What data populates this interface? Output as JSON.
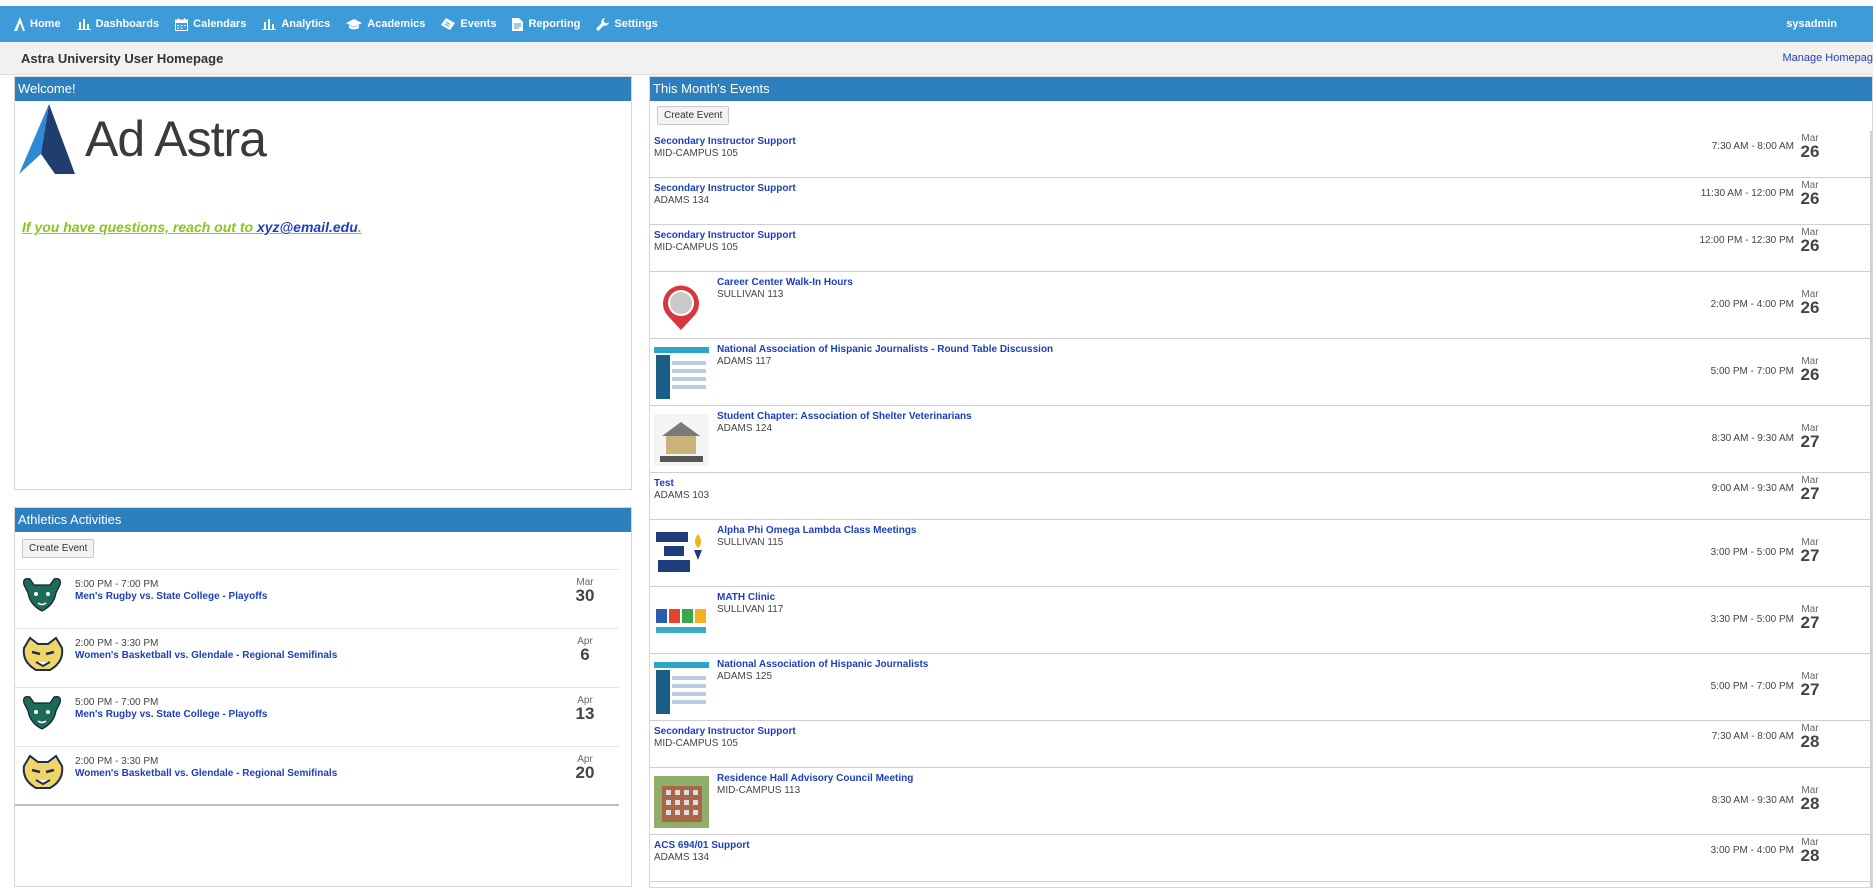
{
  "nav": {
    "items": [
      {
        "label": "Home",
        "icon": "astra-icon"
      },
      {
        "label": "Dashboards",
        "icon": "bar-chart-icon"
      },
      {
        "label": "Calendars",
        "icon": "calendar-icon"
      },
      {
        "label": "Analytics",
        "icon": "bar-chart-icon"
      },
      {
        "label": "Academics",
        "icon": "graduation-cap-icon"
      },
      {
        "label": "Events",
        "icon": "ticket-icon"
      },
      {
        "label": "Reporting",
        "icon": "document-icon"
      },
      {
        "label": "Settings",
        "icon": "wrench-icon"
      }
    ],
    "user": "sysadmin",
    "bar_color": "#3c9bd8"
  },
  "page": {
    "title": "Astra University User Homepage",
    "manage_link": "Manage Homepag"
  },
  "welcome": {
    "header": "Welcome!",
    "logo_text": "Ad Astra",
    "message_prefix": "If you have questions, reach out to ",
    "email": "xyz@email.edu",
    "message_suffix": "."
  },
  "athletics": {
    "header": "Athletics Activities",
    "create_label": "Create Event",
    "items": [
      {
        "time": "5:00 PM - 7:00 PM",
        "name": "Men's Rugby vs. State College - Playoffs",
        "month": "Mar",
        "day": "30",
        "logo": "bison-icon"
      },
      {
        "time": "2:00 PM - 3:30 PM",
        "name": "Women's Basketball vs. Glendale - Regional Semifinals",
        "month": "Apr",
        "day": "6",
        "logo": "cougar-icon"
      },
      {
        "time": "5:00 PM - 7:00 PM",
        "name": "Men's Rugby vs. State College - Playoffs",
        "month": "Apr",
        "day": "13",
        "logo": "bison-icon"
      },
      {
        "time": "2:00 PM - 3:30 PM",
        "name": "Women's Basketball vs. Glendale - Regional Semifinals",
        "month": "Apr",
        "day": "20",
        "logo": "cougar-icon"
      }
    ]
  },
  "events": {
    "header": "This Month's Events",
    "create_label": "Create Event",
    "items": [
      {
        "title": "Secondary Instructor Support",
        "location": "MID-CAMPUS 105",
        "time": "7:30 AM - 8:00 AM",
        "month": "Mar",
        "day": "26",
        "icon": ""
      },
      {
        "title": "Secondary Instructor Support",
        "location": "ADAMS 134",
        "time": "11:30 AM - 12:00 PM",
        "month": "Mar",
        "day": "26",
        "icon": ""
      },
      {
        "title": "Secondary Instructor Support",
        "location": "MID-CAMPUS 105",
        "time": "12:00 PM - 12:30 PM",
        "month": "Mar",
        "day": "26",
        "icon": ""
      },
      {
        "title": "Career Center Walk-In Hours",
        "location": "SULLIVAN 113",
        "time": "2:00 PM - 4:00 PM",
        "month": "Mar",
        "day": "26",
        "icon": "career-center-icon"
      },
      {
        "title": "National Association of Hispanic Journalists - Round Table Discussion",
        "location": "ADAMS 117",
        "time": "5:00 PM - 7:00 PM",
        "month": "Mar",
        "day": "26",
        "icon": "nahj-icon"
      },
      {
        "title": "Student Chapter: Association of Shelter Veterinarians",
        "location": "ADAMS 124",
        "time": "8:30 AM - 9:30 AM",
        "month": "Mar",
        "day": "27",
        "icon": "shelter-vet-icon"
      },
      {
        "title": "Test",
        "location": "ADAMS 103",
        "time": "9:00 AM - 9:30 AM",
        "month": "Mar",
        "day": "27",
        "icon": ""
      },
      {
        "title": "Alpha Phi Omega Lambda Class Meetings",
        "location": "SULLIVAN 115",
        "time": "3:00 PM - 5:00 PM",
        "month": "Mar",
        "day": "27",
        "icon": "alpha-phi-omega-icon"
      },
      {
        "title": "MATH Clinic",
        "location": "SULLIVAN 117",
        "time": "3:30 PM - 5:00 PM",
        "month": "Mar",
        "day": "27",
        "icon": "math-clinic-icon"
      },
      {
        "title": "National Association of Hispanic Journalists",
        "location": "ADAMS 125",
        "time": "5:00 PM - 7:00 PM",
        "month": "Mar",
        "day": "27",
        "icon": "nahj-icon"
      },
      {
        "title": "Secondary Instructor Support",
        "location": "MID-CAMPUS 105",
        "time": "7:30 AM - 8:00 AM",
        "month": "Mar",
        "day": "28",
        "icon": ""
      },
      {
        "title": "Residence Hall Advisory Council Meeting",
        "location": "MID-CAMPUS 113",
        "time": "8:30 AM - 9:30 AM",
        "month": "Mar",
        "day": "28",
        "icon": "residence-hall-icon"
      },
      {
        "title": "ACS 694/01 Support",
        "location": "ADAMS 134",
        "time": "3:00 PM - 4:00 PM",
        "month": "Mar",
        "day": "28",
        "icon": ""
      }
    ]
  }
}
